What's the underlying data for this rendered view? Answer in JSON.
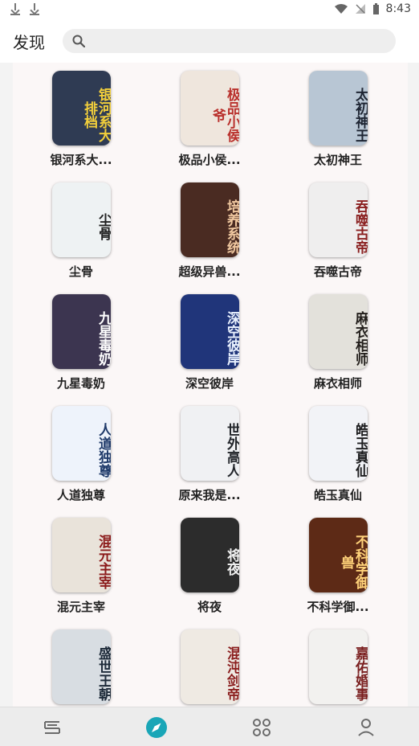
{
  "statusbar": {
    "time": "8:43",
    "left_icons": [
      "download-icon",
      "download-icon"
    ],
    "right_icons": [
      "wifi-icon",
      "signal-icon",
      "battery-icon"
    ]
  },
  "header": {
    "title": "发现",
    "search_placeholder": ""
  },
  "books": [
    {
      "title": "银河系大...",
      "cover_text": "银河系大排档",
      "bg": "#2f3b53",
      "fg": "#f2cf3b"
    },
    {
      "title": "极品小侯...",
      "cover_text": "极品小侯爷",
      "bg": "#efe6dd",
      "fg": "#b9302c"
    },
    {
      "title": "太初神王",
      "cover_text": "太初神王",
      "bg": "#b8c6d4",
      "fg": "#1e2533"
    },
    {
      "title": "尘骨",
      "cover_text": "尘骨",
      "bg": "#eef2f3",
      "fg": "#222222"
    },
    {
      "title": "超级异兽...",
      "cover_text": "培养系统",
      "bg": "#4a2b22",
      "fg": "#f0c8a0"
    },
    {
      "title": "吞噬古帝",
      "cover_text": "吞噬古帝",
      "bg": "#efeeee",
      "fg": "#8a1f1f"
    },
    {
      "title": "九星毒奶",
      "cover_text": "九星毒奶",
      "bg": "#3c3550",
      "fg": "#ffffff"
    },
    {
      "title": "深空彼岸",
      "cover_text": "深空彼岸",
      "bg": "#20357a",
      "fg": "#eaf2ff"
    },
    {
      "title": "麻衣相师",
      "cover_text": "麻衣相师",
      "bg": "#e3e1db",
      "fg": "#231f1c"
    },
    {
      "title": "人道独尊",
      "cover_text": "人道独尊",
      "bg": "#eef3fb",
      "fg": "#1f3a6a"
    },
    {
      "title": "原来我是...",
      "cover_text": "世外高人",
      "bg": "#f0f1f3",
      "fg": "#22252a"
    },
    {
      "title": "皓玉真仙",
      "cover_text": "皓玉真仙",
      "bg": "#f2f3f7",
      "fg": "#1d1d1f"
    },
    {
      "title": "混元主宰",
      "cover_text": "混元主宰",
      "bg": "#e9e3da",
      "fg": "#8b1a1a"
    },
    {
      "title": "将夜",
      "cover_text": "将夜",
      "bg": "#2c2c2c",
      "fg": "#f1f1f1"
    },
    {
      "title": "不科学御...",
      "cover_text": "不科学御兽",
      "bg": "#5d2a16",
      "fg": "#ffd27a"
    },
    {
      "title": "",
      "cover_text": "盛世王朝",
      "bg": "#d8dde2",
      "fg": "#1e2b3a"
    },
    {
      "title": "",
      "cover_text": "混沌剑帝",
      "bg": "#efeae3",
      "fg": "#8b1f1f"
    },
    {
      "title": "",
      "cover_text": "嘉佑婚事",
      "bg": "#f2f1ef",
      "fg": "#7a1f1f"
    }
  ],
  "bottom_nav": [
    {
      "name": "bookshelf",
      "icon": "bookshelf-icon",
      "active": false
    },
    {
      "name": "discover",
      "icon": "compass-icon",
      "active": true
    },
    {
      "name": "categories",
      "icon": "grid-icon",
      "active": false
    },
    {
      "name": "profile",
      "icon": "user-icon",
      "active": false
    }
  ],
  "colors": {
    "accent": "#1aa6b7",
    "nav_bg": "#ececec",
    "content_bg": "#fbf7f7"
  }
}
